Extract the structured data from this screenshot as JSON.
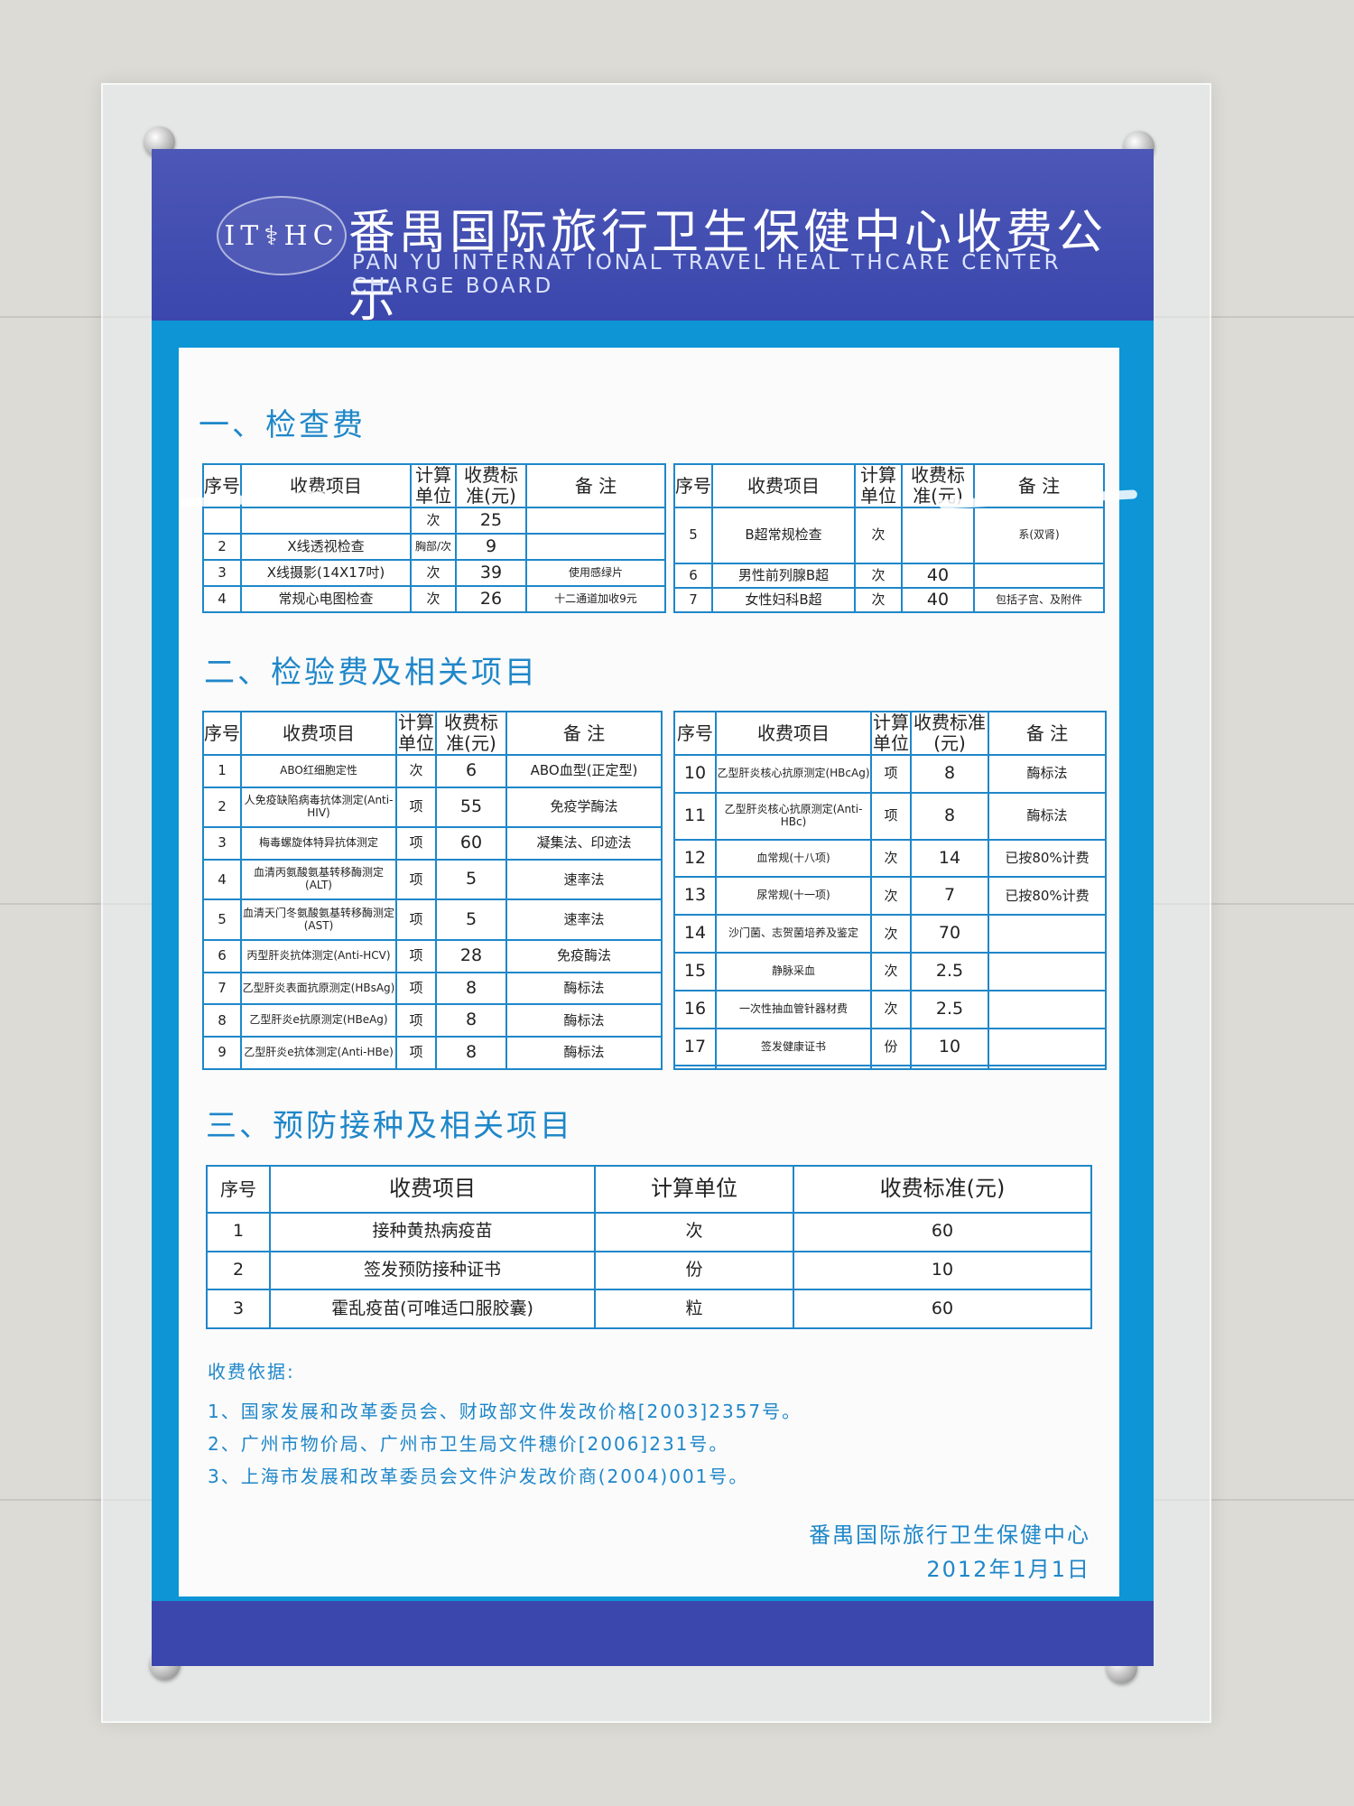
{
  "header": {
    "logo_text": "IT⚕HC",
    "title_cn": "番禺国际旅行卫生保健中心收费公示",
    "title_en": "PAN YU INTERNAT IONAL TRAVEL HEAL THCARE CENTER CHARGE BOARD"
  },
  "section1": {
    "title": "一、检查费",
    "headers": {
      "no": "序号",
      "item": "收费项目",
      "unit": "计算单位",
      "price": "收费标准(元)",
      "remark": "备 注"
    },
    "left_rows": [
      {
        "no": "",
        "item": "",
        "unit": "次",
        "price": "25",
        "remark": ""
      },
      {
        "no": "2",
        "item": "X线透视检查",
        "unit": "胸部/次",
        "price": "9",
        "remark": ""
      },
      {
        "no": "3",
        "item": "X线摄影(14X17吋)",
        "unit": "次",
        "price": "39",
        "remark": "使用感绿片"
      },
      {
        "no": "4",
        "item": "常规心电图检查",
        "unit": "次",
        "price": "26",
        "remark": "十二通道加收9元"
      }
    ],
    "right_rows": [
      {
        "no": "5",
        "item": "B超常规检查",
        "unit": "次",
        "price": "",
        "remark": "系(双肾)"
      },
      {
        "no": "6",
        "item": "男性前列腺B超",
        "unit": "次",
        "price": "40",
        "remark": ""
      },
      {
        "no": "7",
        "item": "女性妇科B超",
        "unit": "次",
        "price": "40",
        "remark": "包括子宫、及附件"
      }
    ]
  },
  "section2": {
    "title": "二、检验费及相关项目",
    "headers": {
      "no": "序号",
      "item": "收费项目",
      "unit": "计算单位",
      "price": "收费标准(元)",
      "remark": "备 注"
    },
    "left_rows": [
      {
        "no": "1",
        "item": "ABO红细胞定性",
        "unit": "次",
        "price": "6",
        "remark": "ABO血型(正定型)"
      },
      {
        "no": "2",
        "item": "人免疫缺陷病毒抗体测定(Anti-HIV)",
        "unit": "项",
        "price": "55",
        "remark": "免疫学酶法"
      },
      {
        "no": "3",
        "item": "梅毒螺旋体特异抗体测定",
        "unit": "项",
        "price": "60",
        "remark": "凝集法、印迹法"
      },
      {
        "no": "4",
        "item": "血清丙氨酸氨基转移酶测定(ALT)",
        "unit": "项",
        "price": "5",
        "remark": "速率法"
      },
      {
        "no": "5",
        "item": "血清天门冬氨酸氨基转移酶测定(AST)",
        "unit": "项",
        "price": "5",
        "remark": "速率法"
      },
      {
        "no": "6",
        "item": "丙型肝炎抗体测定(Anti-HCV)",
        "unit": "项",
        "price": "28",
        "remark": "免疫酶法"
      },
      {
        "no": "7",
        "item": "乙型肝炎表面抗原测定(HBsAg)",
        "unit": "项",
        "price": "8",
        "remark": "酶标法"
      },
      {
        "no": "8",
        "item": "乙型肝炎e抗原测定(HBeAg)",
        "unit": "项",
        "price": "8",
        "remark": "酶标法"
      },
      {
        "no": "9",
        "item": "乙型肝炎e抗体测定(Anti-HBe)",
        "unit": "项",
        "price": "8",
        "remark": "酶标法"
      }
    ],
    "right_rows": [
      {
        "no": "10",
        "item": "乙型肝炎核心抗原测定(HBcAg)",
        "unit": "项",
        "price": "8",
        "remark": "酶标法"
      },
      {
        "no": "11",
        "item": "乙型肝炎核心抗原测定(Anti-HBc)",
        "unit": "项",
        "price": "8",
        "remark": "酶标法"
      },
      {
        "no": "12",
        "item": "血常规(十八项)",
        "unit": "次",
        "price": "14",
        "remark": "已按80%计费"
      },
      {
        "no": "13",
        "item": "尿常规(十一项)",
        "unit": "次",
        "price": "7",
        "remark": "已按80%计费"
      },
      {
        "no": "14",
        "item": "沙门菌、志贺菌培养及鉴定",
        "unit": "次",
        "price": "70",
        "remark": ""
      },
      {
        "no": "15",
        "item": "静脉采血",
        "unit": "次",
        "price": "2.5",
        "remark": ""
      },
      {
        "no": "16",
        "item": "一次性抽血管针器材费",
        "unit": "次",
        "price": "2.5",
        "remark": ""
      },
      {
        "no": "17",
        "item": "签发健康证书",
        "unit": "份",
        "price": "10",
        "remark": ""
      },
      {
        "no": "",
        "item": "",
        "unit": "",
        "price": "",
        "remark": ""
      }
    ]
  },
  "section3": {
    "title": "三、预防接种及相关项目",
    "headers": {
      "no": "序号",
      "item": "收费项目",
      "unit": "计算单位",
      "price": "收费标准(元)"
    },
    "rows": [
      {
        "no": "1",
        "item": "接种黄热病疫苗",
        "unit": "次",
        "price": "60"
      },
      {
        "no": "2",
        "item": "签发预防接种证书",
        "unit": "份",
        "price": "10"
      },
      {
        "no": "3",
        "item": "霍乱疫苗(可唯适口服胶囊)",
        "unit": "粒",
        "price": "60"
      }
    ]
  },
  "basis": {
    "title": "收费依据:",
    "items": [
      "1、国家发展和改革委员会、财政部文件发改价格[2003]2357号。",
      "2、广州市物价局、广州市卫生局文件穗价[2006]231号。",
      "3、上海市发展和改革委员会文件沪发改价商(2004)001号。"
    ]
  },
  "signature": {
    "org": "番禺国际旅行卫生保健中心",
    "date": "2012年1月1日"
  }
}
